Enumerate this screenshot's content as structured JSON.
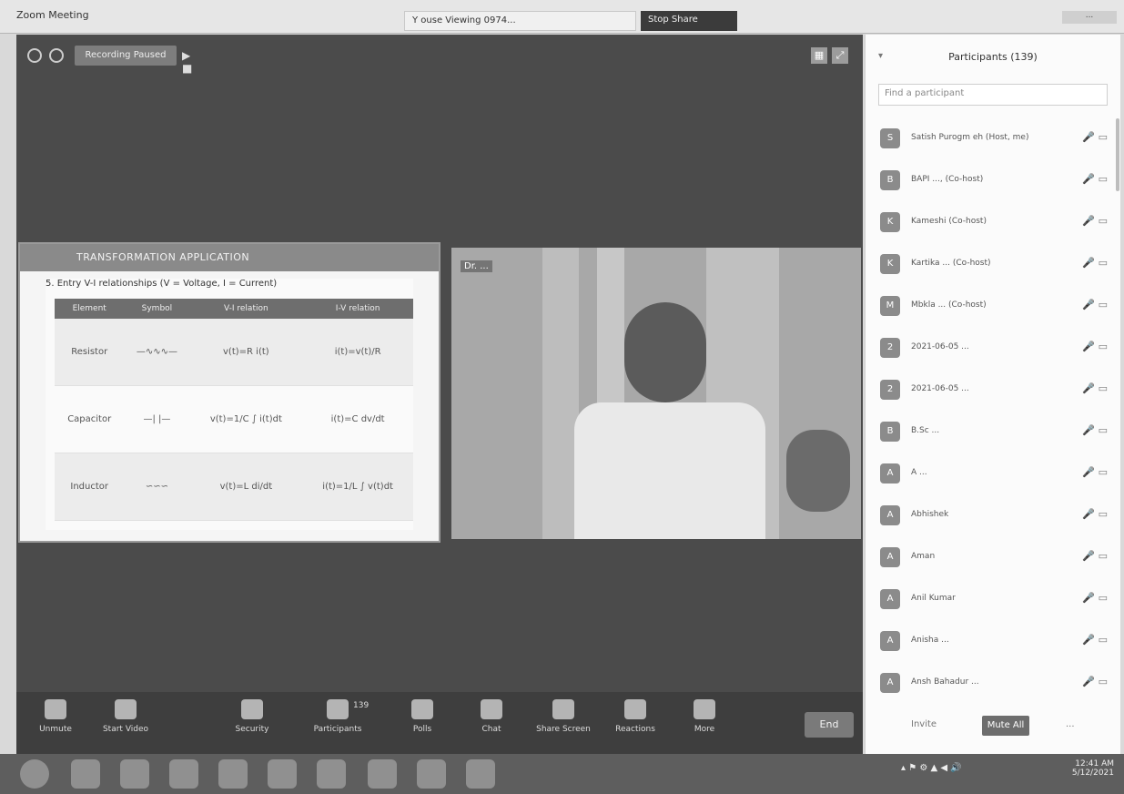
{
  "window": {
    "app_title": "Zoom Meeting",
    "tab1": "Y ouse Viewing 0974...",
    "tab2": "Stop Share",
    "controls": "..."
  },
  "meeting": {
    "recording_label": "Recording Paused"
  },
  "share": {
    "title": "TRANSFORMATION APPLICATION",
    "slide_subtitle": "5. Entry V-I relationships (V = Voltage, I = Current)",
    "table": {
      "headers": [
        "Element",
        "Symbol",
        "V-I relation",
        "I-V relation"
      ],
      "rows": [
        {
          "element": "Resistor",
          "symbol": "—∿∿∿—",
          "vi": "v(t)=R i(t)",
          "iv": "i(t)=v(t)/R"
        },
        {
          "element": "Capacitor",
          "symbol": "—| |—",
          "vi": "v(t)=1/C ∫ i(t)dt",
          "iv": "i(t)=C dv/dt"
        },
        {
          "element": "Inductor",
          "symbol": "∽∽∽",
          "vi": "v(t)=L di/dt",
          "iv": "i(t)=1/L ∫ v(t)dt"
        }
      ]
    }
  },
  "video": {
    "name": "Dr. ..."
  },
  "toolbar": {
    "items": [
      {
        "label": "Unmute"
      },
      {
        "label": "Start Video"
      },
      {
        "label": "Security"
      },
      {
        "label": "Participants"
      },
      {
        "label": "Polls"
      },
      {
        "label": "Chat"
      },
      {
        "label": "Share Screen"
      },
      {
        "label": "Reactions"
      },
      {
        "label": "More"
      }
    ],
    "participant_count": "139",
    "end_label": "End"
  },
  "participants_panel": {
    "title": "Participants (139)",
    "search_placeholder": "Find a participant",
    "people": [
      {
        "name": "Satish Purogm eh (Host, me)",
        "avatar": "S"
      },
      {
        "name": "BAPI ..., (Co-host)",
        "avatar": "B"
      },
      {
        "name": "Kameshi (Co-host)",
        "avatar": "K"
      },
      {
        "name": "Kartika ... (Co-host)",
        "avatar": "K"
      },
      {
        "name": "Mbkla ... (Co-host)",
        "avatar": "M"
      },
      {
        "name": "2021-06-05 ...",
        "avatar": "2"
      },
      {
        "name": "2021-06-05 ...",
        "avatar": "2"
      },
      {
        "name": "B.Sc ...",
        "avatar": "B"
      },
      {
        "name": "A ...",
        "avatar": "A"
      },
      {
        "name": "Abhishek",
        "avatar": "A"
      },
      {
        "name": "Aman",
        "avatar": "A"
      },
      {
        "name": "Anil Kumar",
        "avatar": "A"
      },
      {
        "name": "Anisha ...",
        "avatar": "A"
      },
      {
        "name": "Ansh Bahadur ...",
        "avatar": "A"
      }
    ],
    "footer": {
      "invite": "Invite",
      "mute_all": "Mute All",
      "more": "..."
    }
  },
  "taskbar": {
    "clock_time": "12:41 AM",
    "clock_date": "5/12/2021"
  },
  "colors": {
    "stage": "#4b4b4b",
    "panel": "#fbfbfb",
    "toolbar": "#3e3e3e"
  }
}
